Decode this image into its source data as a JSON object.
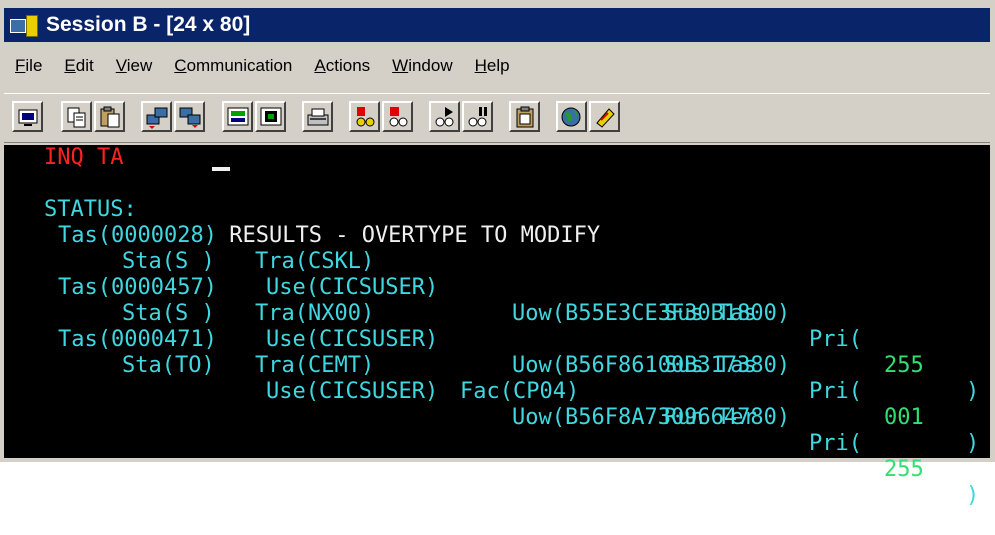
{
  "window": {
    "title": "Session B - [24 x 80]"
  },
  "menu": [
    {
      "pre": "",
      "u": "F",
      "post": "ile"
    },
    {
      "pre": "",
      "u": "E",
      "post": "dit"
    },
    {
      "pre": "",
      "u": "V",
      "post": "iew"
    },
    {
      "pre": "",
      "u": "C",
      "post": "ommunication"
    },
    {
      "pre": "",
      "u": "A",
      "post": "ctions"
    },
    {
      "pre": "",
      "u": "W",
      "post": "indow"
    },
    {
      "pre": "",
      "u": "H",
      "post": "elp"
    }
  ],
  "toolbar": {
    "icons": [
      "display-icon",
      "copy-icon",
      "paste-icon",
      "send-file-icon",
      "receive-file-icon",
      "keypad-icon",
      "map-icon",
      "print-screen-icon",
      "record-macro-icon",
      "stop-macro-icon",
      "play-macro-icon",
      "pause-macro-icon",
      "clipboard-icon",
      "globe-icon",
      "help-icon"
    ]
  },
  "terminal": {
    "command": "INQ TA",
    "status_label": "STATUS:",
    "status_text": " RESULTS - OVERTYPE TO MODIFY",
    "rows": [
      {
        "tas": "Tas(0000028)",
        "tra": "Tra(CSKL)",
        "fac": "",
        "state": "Sus Tas",
        "pri_label": "Pri(",
        "pri": "255",
        "close": ")",
        "sta": "Sta(S )",
        "use": "Use(CICSUSER)",
        "uow": "Uow(B55E3CE3F30B1800)"
      },
      {
        "tas": "Tas(0000457)",
        "tra": "Tra(NX00)",
        "fac": "",
        "state": "Sus Tas",
        "pri_label": "Pri(",
        "pri": "001",
        "close": ")",
        "sta": "Sta(S )",
        "use": "Use(CICSUSER)",
        "uow": "Uow(B56F86100B317380)"
      },
      {
        "tas": "Tas(0000471)",
        "tra": "Tra(CEMT)",
        "fac": "Fac(CP04)",
        "state": "Run Ter",
        "pri_label": "Pri(",
        "pri": "255",
        "close": ")",
        "sta": "Sta(TO)",
        "use": "Use(CICSUSER)",
        "uow": "Uow(B56F8A7309664780)"
      }
    ]
  },
  "colors": {
    "terminal_bg": "#000000",
    "command": "#ff2020",
    "fields": "#40d8e0",
    "values": "#30e070",
    "status": "#f0f0f0",
    "titlebar": "#0a246a"
  }
}
